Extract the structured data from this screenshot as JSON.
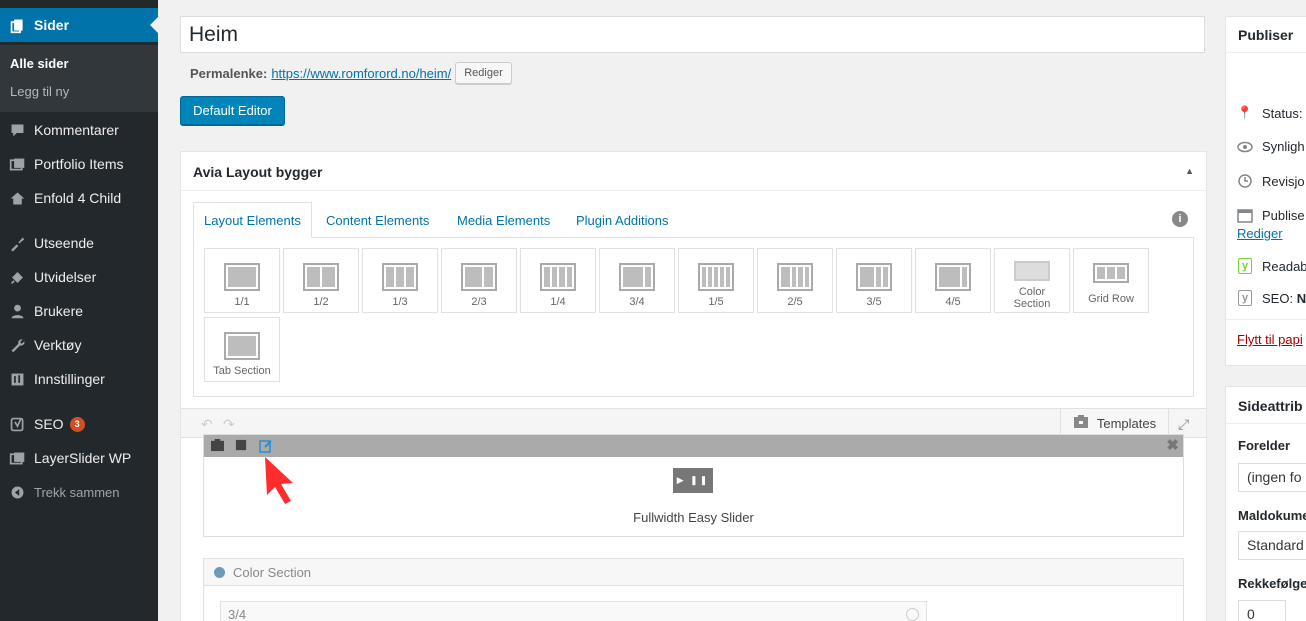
{
  "sidebar": {
    "pages_label": "Sider",
    "sub_all": "Alle sider",
    "sub_add": "Legg til ny",
    "items": [
      {
        "label": "Kommentarer",
        "icon": "comment-icon"
      },
      {
        "label": "Portfolio Items",
        "icon": "portfolio-icon"
      },
      {
        "label": "Enfold 4 Child",
        "icon": "home-icon"
      },
      {
        "label": "Utseende",
        "icon": "brush-icon"
      },
      {
        "label": "Utvidelser",
        "icon": "plugin-icon"
      },
      {
        "label": "Brukere",
        "icon": "user-icon"
      },
      {
        "label": "Verktøy",
        "icon": "wrench-icon"
      },
      {
        "label": "Innstillinger",
        "icon": "settings-icon"
      },
      {
        "label": "SEO",
        "icon": "yoast-icon",
        "badge": "3"
      },
      {
        "label": "LayerSlider WP",
        "icon": "layers-icon"
      }
    ],
    "collapse": "Trekk sammen"
  },
  "editor": {
    "title_value": "Heim",
    "permalink_label": "Permalenke:",
    "permalink_url": "https://www.romforord.no/heim/",
    "permalink_edit": "Rediger",
    "default_editor": "Default Editor"
  },
  "avia": {
    "title": "Avia Layout bygger",
    "tabs": [
      "Layout Elements",
      "Content Elements",
      "Media Elements",
      "Plugin Additions"
    ],
    "elements": [
      "1/1",
      "1/2",
      "1/3",
      "2/3",
      "1/4",
      "3/4",
      "1/5",
      "2/5",
      "3/5",
      "4/5",
      "Color Section",
      "Grid Row",
      "Tab Section"
    ],
    "templates": "Templates",
    "slider_name": "Fullwidth Easy Slider",
    "color_section": "Color Section",
    "column_label": "3/4"
  },
  "publish": {
    "title": "Publiser",
    "status": "Status:",
    "visibility": "Synligh",
    "revisions": "Revisjo",
    "publish_date": "Publise",
    "edit_link": "Rediger",
    "readability": "Readabi",
    "seo": "SEO: ",
    "seo_value": "No",
    "trash": "Flytt til papi"
  },
  "attributes": {
    "title": "Sideattrib",
    "parent_label": "Forelder",
    "parent_value": "(ingen fo",
    "template_label": "Maldokume",
    "template_value": "Standard",
    "order_label": "Rekkefølge",
    "order_value": "0"
  },
  "colors": {
    "accent": "#0073aa",
    "sidebar": "#23282d",
    "arrow": "#ff2d2d"
  }
}
